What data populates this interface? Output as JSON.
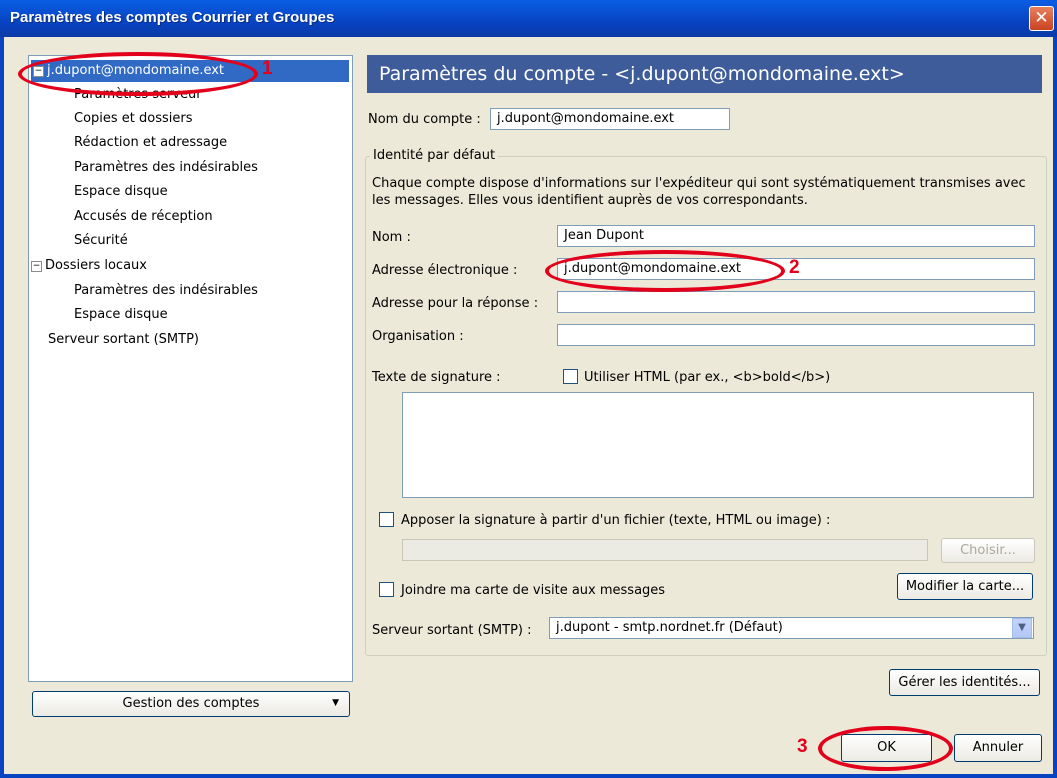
{
  "window": {
    "title": "Paramètres des comptes Courrier et Groupes",
    "close_glyph": "✕"
  },
  "tree": {
    "account": "j.dupont@mondomaine.ext",
    "account_items": [
      "Paramètres serveur",
      "Copies et dossiers",
      "Rédaction et adressage",
      "Paramètres des indésirables",
      "Espace disque",
      "Accusés de réception",
      "Sécurité"
    ],
    "local": "Dossiers locaux",
    "local_items": [
      "Paramètres des indésirables",
      "Espace disque"
    ],
    "smtp": "Serveur sortant (SMTP)"
  },
  "account_management_button": "Gestion des comptes",
  "header": "Paramètres du compte - <j.dupont@mondomaine.ext>",
  "account_name": {
    "label": "Nom du compte :",
    "value": "j.dupont@mondomaine.ext"
  },
  "identity": {
    "legend": "Identité par défaut",
    "description": "Chaque compte dispose d'informations sur l'expéditeur qui sont systématiquement transmises avec les messages. Elles vous identifient auprès de vos correspondants.",
    "name_label": "Nom :",
    "name_value": "Jean Dupont",
    "email_label": "Adresse électronique :",
    "email_value": "j.dupont@mondomaine.ext",
    "reply_label": "Adresse pour la réponse :",
    "reply_value": "",
    "org_label": "Organisation :",
    "org_value": "",
    "signature_label": "Texte de signature :",
    "use_html_label": "Utiliser HTML (par ex., <b>bold</b>)",
    "attach_file_label": "Apposer la signature à partir d'un fichier (texte, HTML ou image) :",
    "choose_button": "Choisir...",
    "vcard_label": "Joindre ma carte de visite aux messages",
    "edit_card_button": "Modifier la carte...",
    "smtp_label": "Serveur sortant (SMTP) :",
    "smtp_value": "j.dupont - smtp.nordnet.fr (Défaut)"
  },
  "manage_identities_button": "Gérer les identités...",
  "ok_button": "OK",
  "cancel_button": "Annuler",
  "annotations": [
    "1",
    "2",
    "3"
  ],
  "colors": {
    "annotation": "#e3001b",
    "header": "#3e5c99",
    "selection": "#316ac5"
  }
}
